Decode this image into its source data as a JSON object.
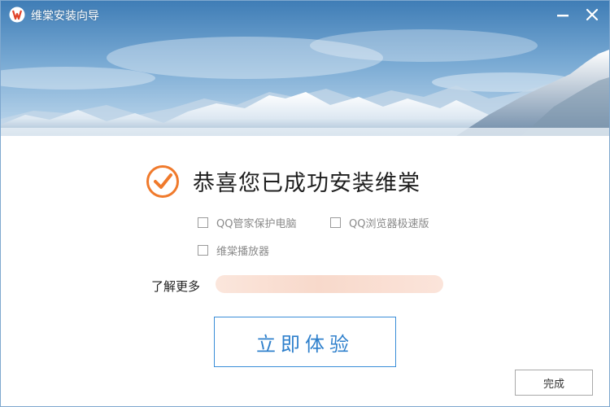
{
  "window": {
    "title": "维棠安装向导",
    "logo_icon": "weitang-logo-icon",
    "minimize_icon": "minimize-icon",
    "close_icon": "close-icon"
  },
  "content": {
    "success_icon": "check-circle-icon",
    "headline": "恭喜您已成功安装维棠",
    "options": [
      {
        "label": "QQ管家保护电脑",
        "checked": false
      },
      {
        "label": "QQ浏览器极速版",
        "checked": false
      },
      {
        "label": "维棠播放器",
        "checked": false
      }
    ],
    "learn_more_label": "了解更多",
    "primary_button": "立即体验",
    "finish_button": "完成"
  },
  "colors": {
    "accent": "#f07a2c",
    "button_blue": "#2f80cc"
  }
}
